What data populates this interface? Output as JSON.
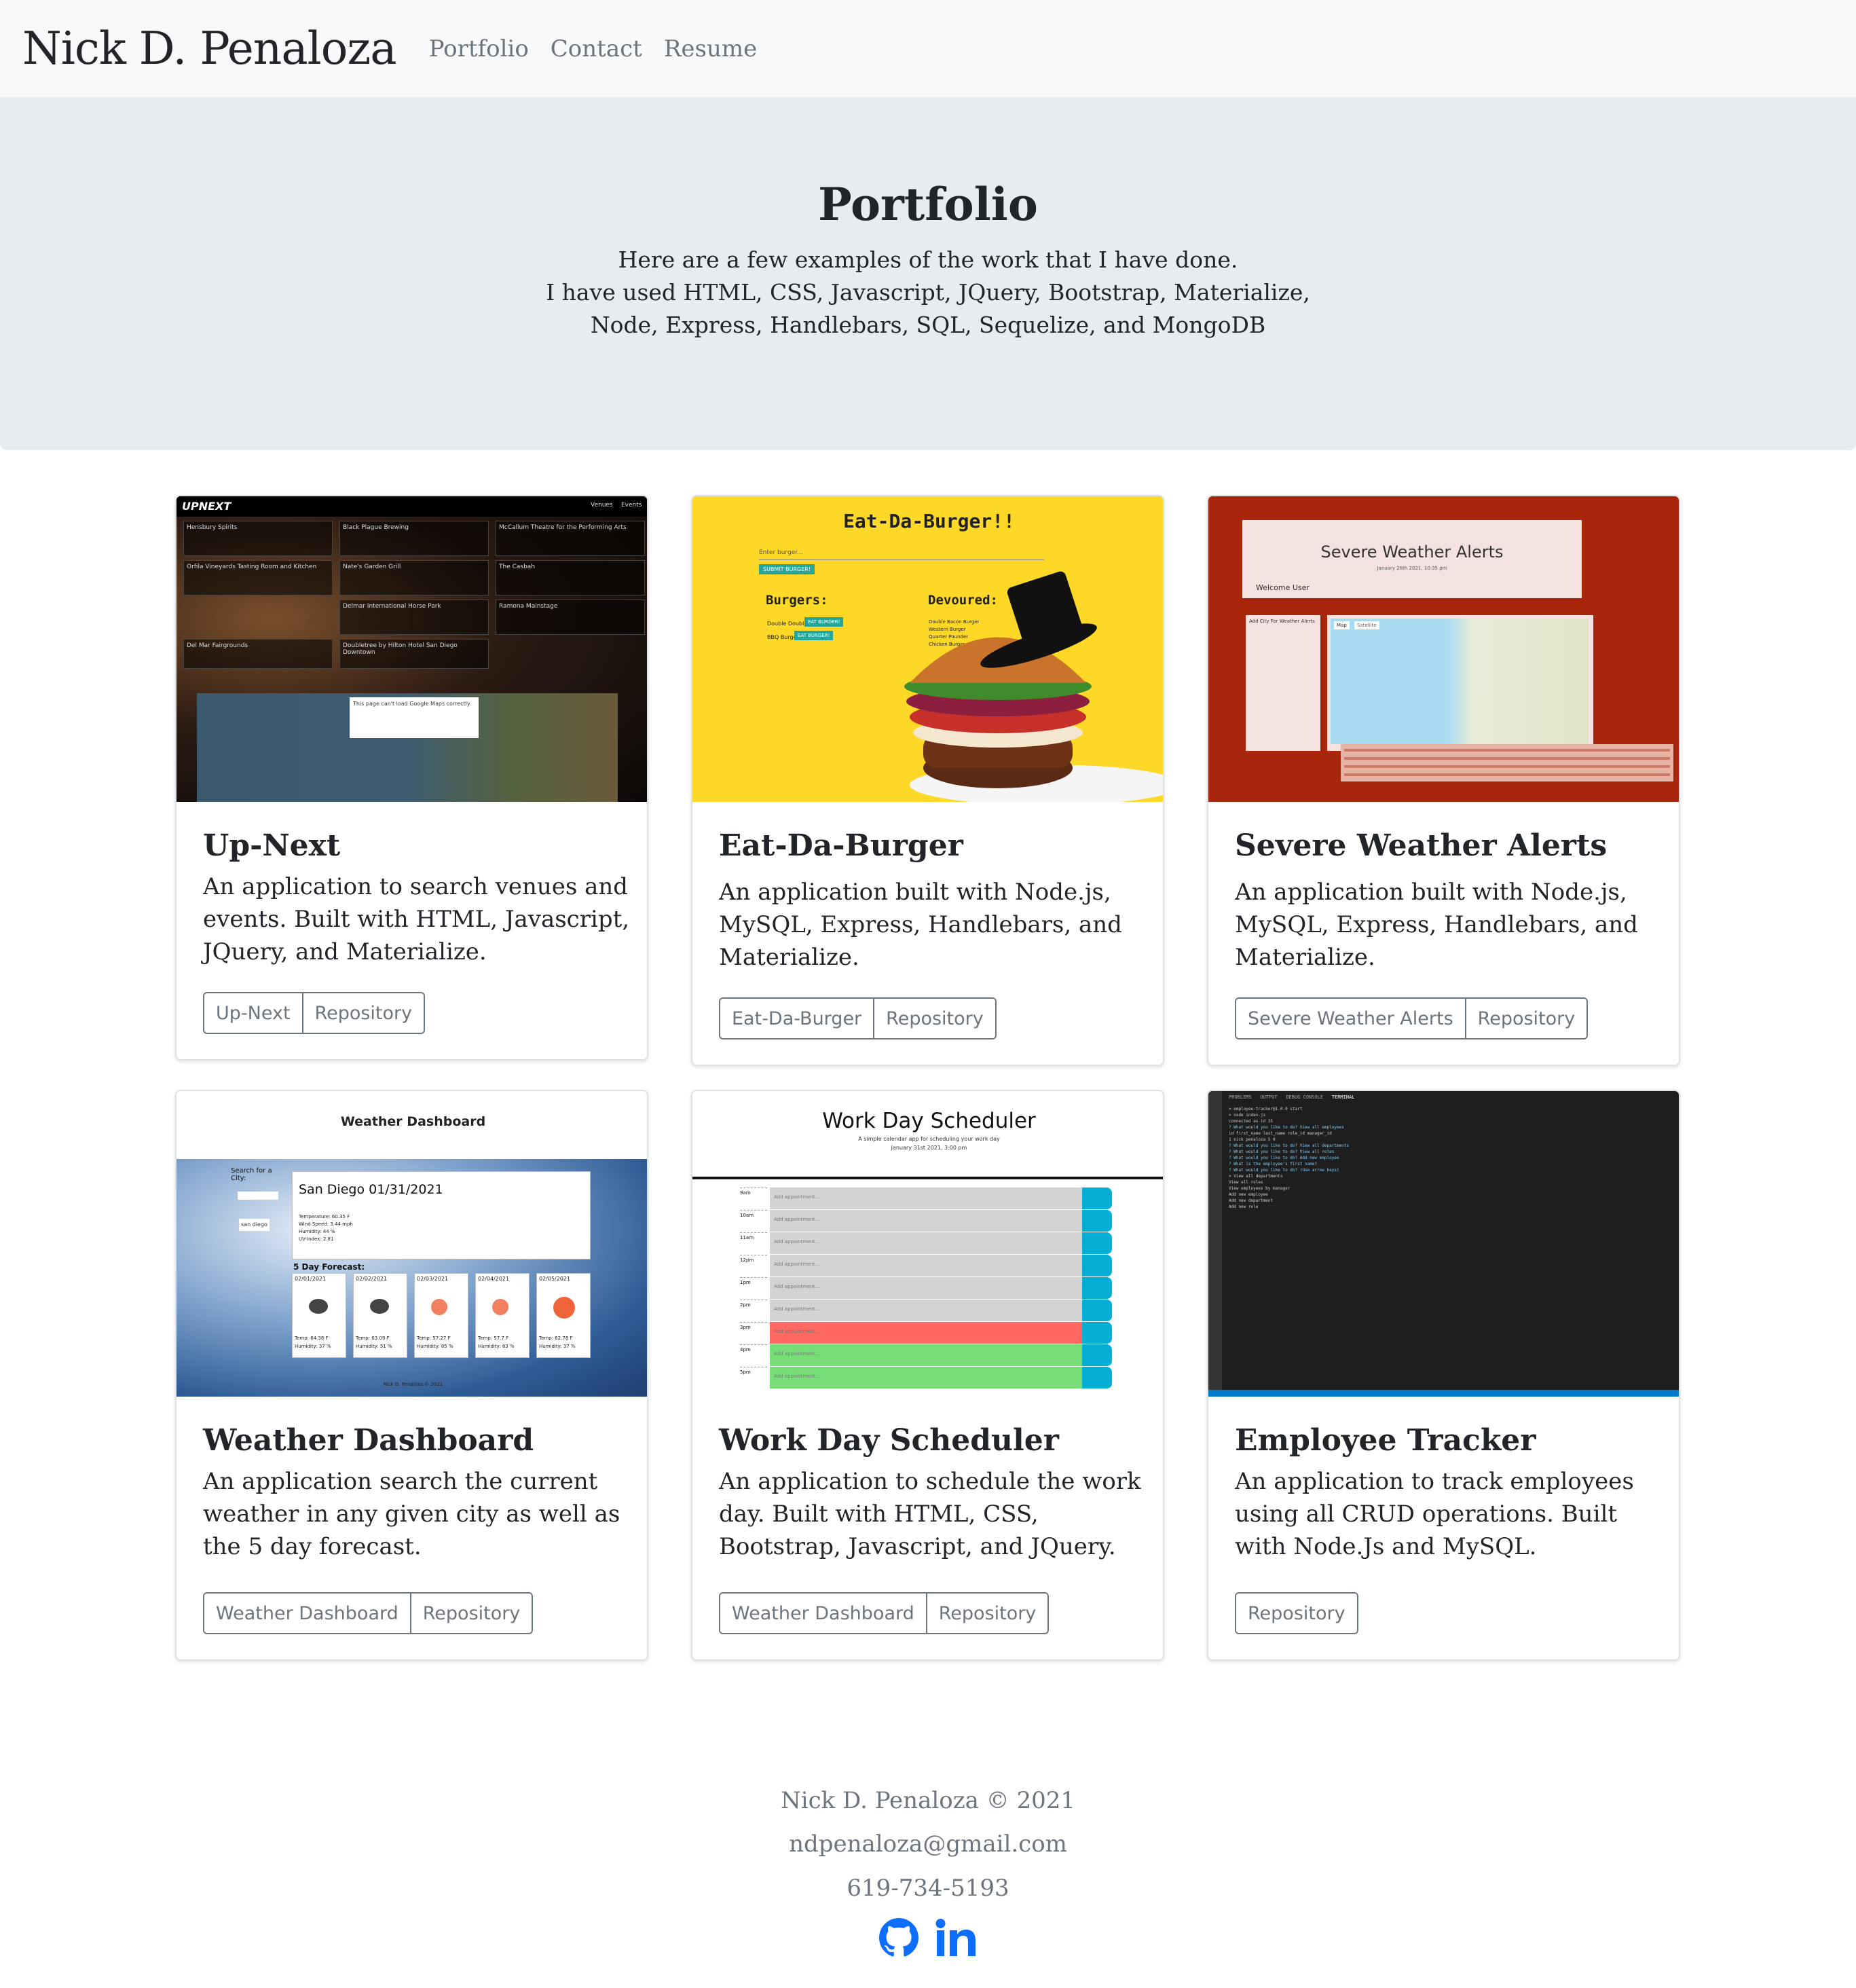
{
  "navbar": {
    "brand": "Nick D. Penaloza",
    "links": [
      "Portfolio",
      "Contact",
      "Resume"
    ]
  },
  "jumbotron": {
    "title": "Portfolio",
    "lines": [
      "Here are a few examples of the work that I have done.",
      "I have used HTML, CSS, Javascript, JQuery, Bootstrap, Materialize,",
      "Node, Express, Handlebars, SQL, Sequelize, and MongoDB"
    ]
  },
  "projects": [
    {
      "title": "Up-Next",
      "description": "An application to search venues and events. Built with HTML, Javascript, JQuery, and Materialize.",
      "buttons": [
        "Up-Next",
        "Repository"
      ],
      "screenshot": {
        "logo": "UPNEXT",
        "nav": [
          "Venues",
          "Events"
        ],
        "venues": [
          "Hensbury Spirits",
          "Black Plague Brewing",
          "McCallum Theatre for the Performing Arts",
          "Orfila Vineyards Tasting Room and Kitchen",
          "Nate's Garden Grill",
          "The Casbah",
          "Delmar International Horse Park",
          "Ramona Mainstage",
          "Del Mar Fairgrounds",
          "Doubletree by Hilton Hotel San Diego Downtown"
        ],
        "dialog": "This page can't load Google Maps correctly."
      }
    },
    {
      "title": "Eat-Da-Burger",
      "description": "An application built with Node.js, MySQL, Express, Handlebars, and Materialize.",
      "buttons": [
        "Eat-Da-Burger",
        "Repository"
      ],
      "screenshot": {
        "heading": "Eat-Da-Burger!!",
        "input": "Enter burger...",
        "submit": "SUBMIT BURGER!",
        "burgers_label": "Burgers:",
        "devoured_label": "Devoured:",
        "burgers": [
          "Double Double",
          "BBQ Burger"
        ],
        "eat_button": "EAT BURGER!",
        "devoured": [
          "Double Bacon Burger",
          "Western Burger",
          "Quarter Pounder",
          "Chicken Burger"
        ]
      }
    },
    {
      "title": "Severe Weather Alerts",
      "description": "An application built with Node.js, MySQL, Express, Handlebars, and Materialize.",
      "buttons": [
        "Severe Weather Alerts",
        "Repository"
      ],
      "screenshot": {
        "heading": "Severe Weather Alerts",
        "date": "January 26th 2021, 10:35 pm",
        "welcome": "Welcome User",
        "add_city": "Add City For Weather Alerts",
        "map_tabs": [
          "Map",
          "Satellite"
        ]
      }
    },
    {
      "title": "Weather Dashboard",
      "description": "An application search the current weather in any given city as well as the 5 day forecast.",
      "buttons": [
        "Weather Dashboard",
        "Repository"
      ],
      "screenshot": {
        "heading": "Weather Dashboard",
        "search_label": "Search for a City:",
        "search_value": "san diego",
        "city": "San Diego 01/31/2021",
        "stats": [
          "Temperature: 60.35 F",
          "Wind Speed: 3.44 mph",
          "Humidity: 44 %",
          "UV-Index: 2.81"
        ],
        "forecast_label": "5 Day Forecast:",
        "days": [
          {
            "date": "02/01/2021",
            "temp": "Temp: 64.38 F",
            "hum": "Humidity: 37 %"
          },
          {
            "date": "02/02/2021",
            "temp": "Temp: 63.09 F",
            "hum": "Humidity: 51 %"
          },
          {
            "date": "02/03/2021",
            "temp": "Temp: 57.27 F",
            "hum": "Humidity: 85 %"
          },
          {
            "date": "02/04/2021",
            "temp": "Temp: 57.7 F",
            "hum": "Humidity: 83 %"
          },
          {
            "date": "02/05/2021",
            "temp": "Temp: 62.78 F",
            "hum": "Humidity: 37 %"
          }
        ],
        "footer": "Nick D. Penaloza © 2021"
      }
    },
    {
      "title": "Work Day Scheduler",
      "description": "An application to schedule the work day. Built with HTML, CSS, Bootstrap, Javascript, and JQuery.",
      "buttons": [
        "Weather Dashboard",
        "Repository"
      ],
      "screenshot": {
        "heading": "Work Day Scheduler",
        "subtitle": "A simple calendar app for scheduling your work day",
        "date": "January 31st 2021, 3:00 pm",
        "hours": [
          "9am",
          "10am",
          "11am",
          "12pm",
          "1pm",
          "2pm",
          "3pm",
          "4pm",
          "5pm"
        ],
        "placeholder": "Add appointment...",
        "row_states": [
          "past",
          "past",
          "past",
          "past",
          "past",
          "past",
          "present",
          "future",
          "future"
        ]
      }
    },
    {
      "title": "Employee Tracker",
      "description": "An application to track employees using all CRUD operations. Built with Node.Js and MySQL.",
      "buttons": [
        "Repository"
      ],
      "screenshot": {
        "tabs": [
          "PROBLEMS",
          "OUTPUT",
          "DEBUG CONSOLE",
          "TERMINAL"
        ],
        "lines": [
          "> employee-tracker@1.0.0 start",
          "> node index.js",
          "connected as id 35",
          "? What would you like to do? View all employees",
          "id  first_name  last_name  role_id  manager_id",
          "1   nick        penaloza   5        0",
          "? What would you like to do? View all departments",
          "? What would you like to do? View all roles",
          "? What would you like to do? Add new employee",
          "? What is the employee's first name?",
          "? What would you like to do? (Use arrow keys)",
          "> View all departments",
          "  View all roles",
          "  View employees by manager",
          "  Add new employee",
          "  Add new department",
          "  Add new role"
        ]
      }
    }
  ],
  "footer": {
    "copyright": "Nick D. Penaloza © 2021",
    "email": "ndpenaloza@gmail.com",
    "phone": "619-734-5193"
  },
  "colors": {
    "navbar_bg": "#f8f9fa",
    "jumbotron_bg": "#e9ecef",
    "text": "#212529",
    "muted": "#6c757d",
    "social_icon": "#0d6efd"
  },
  "icons": [
    "github-icon",
    "linkedin-icon"
  ]
}
